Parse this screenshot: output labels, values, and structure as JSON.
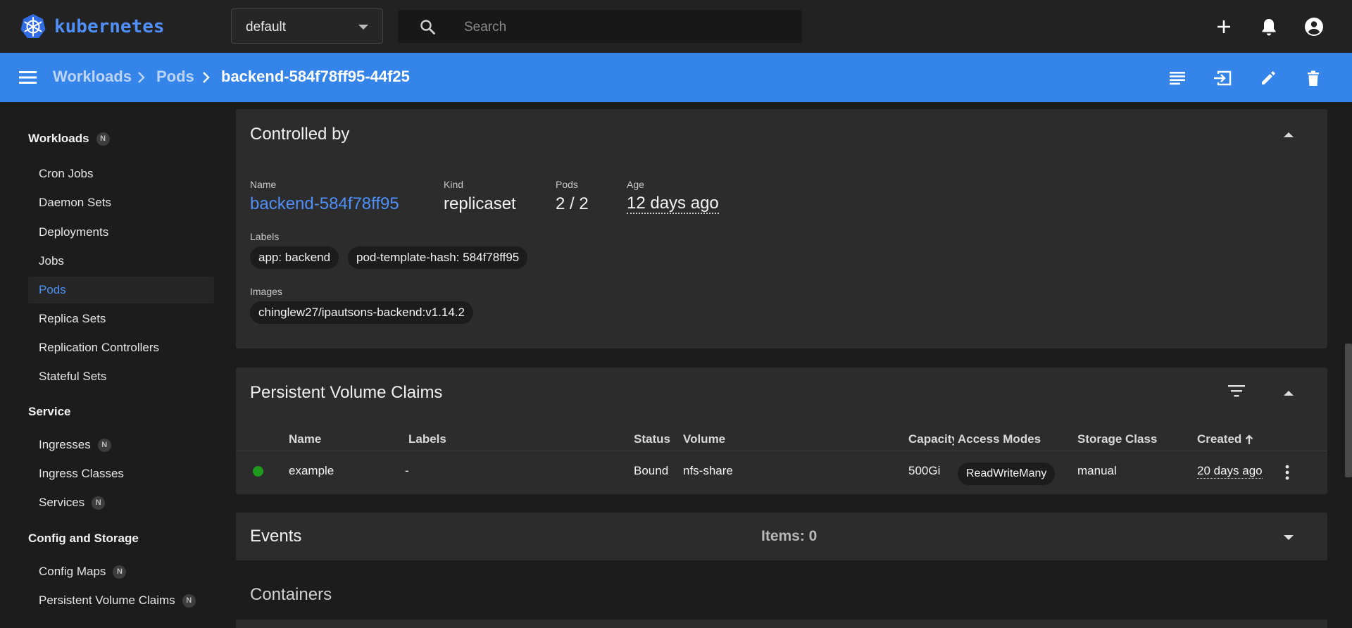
{
  "app": {
    "name": "kubernetes"
  },
  "topbar": {
    "namespace": "default",
    "search_placeholder": "Search",
    "icons": [
      "plus-icon",
      "bell-icon",
      "account-icon"
    ]
  },
  "header": {
    "breadcrumb": [
      "Workloads",
      "Pods"
    ],
    "current": "backend-584f78ff95-44f25",
    "icons": [
      "logs-icon",
      "exec-icon",
      "edit-icon",
      "delete-icon"
    ]
  },
  "sidebar": {
    "badge": "N",
    "groups": [
      {
        "label": "Workloads",
        "badge": true,
        "items": [
          {
            "label": "Cron Jobs"
          },
          {
            "label": "Daemon Sets"
          },
          {
            "label": "Deployments"
          },
          {
            "label": "Jobs"
          },
          {
            "label": "Pods",
            "active": true
          },
          {
            "label": "Replica Sets"
          },
          {
            "label": "Replication Controllers"
          },
          {
            "label": "Stateful Sets"
          }
        ]
      },
      {
        "label": "Service",
        "items": [
          {
            "label": "Ingresses",
            "badge": true
          },
          {
            "label": "Ingress Classes"
          },
          {
            "label": "Services",
            "badge": true
          }
        ]
      },
      {
        "label": "Config and Storage",
        "items": [
          {
            "label": "Config Maps",
            "badge": true
          },
          {
            "label": "Persistent Volume Claims",
            "badge": true
          }
        ]
      }
    ]
  },
  "controlled_by": {
    "title": "Controlled by",
    "name_label": "Name",
    "name_value": "backend-584f78ff95",
    "kind_label": "Kind",
    "kind_value": "replicaset",
    "pods_label": "Pods",
    "pods_value": "2 / 2",
    "age_label": "Age",
    "age_value": "12 days ago",
    "labels_label": "Labels",
    "labels": [
      "app: backend",
      "pod-template-hash: 584f78ff95"
    ],
    "images_label": "Images",
    "images": [
      "chinglew27/ipautsons-backend:v1.14.2"
    ]
  },
  "pvc": {
    "title": "Persistent Volume Claims",
    "columns": [
      "Name",
      "Labels",
      "Status",
      "Volume",
      "Capacity",
      "Access Modes",
      "Storage Class",
      "Created"
    ],
    "rows": [
      {
        "status_color": "#1e9a1e",
        "name": "example",
        "labels": "-",
        "status": "Bound",
        "volume": "nfs-share",
        "capacity": "500Gi",
        "access_modes": "ReadWriteMany",
        "storage_class": "manual",
        "created": "20 days ago"
      }
    ]
  },
  "events": {
    "title": "Events",
    "items_label": "Items: 0"
  },
  "containers": {
    "title": "Containers"
  },
  "colors": {
    "accent": "#3584e9",
    "link": "#4f8ff7",
    "running": "#1e9a1e"
  }
}
